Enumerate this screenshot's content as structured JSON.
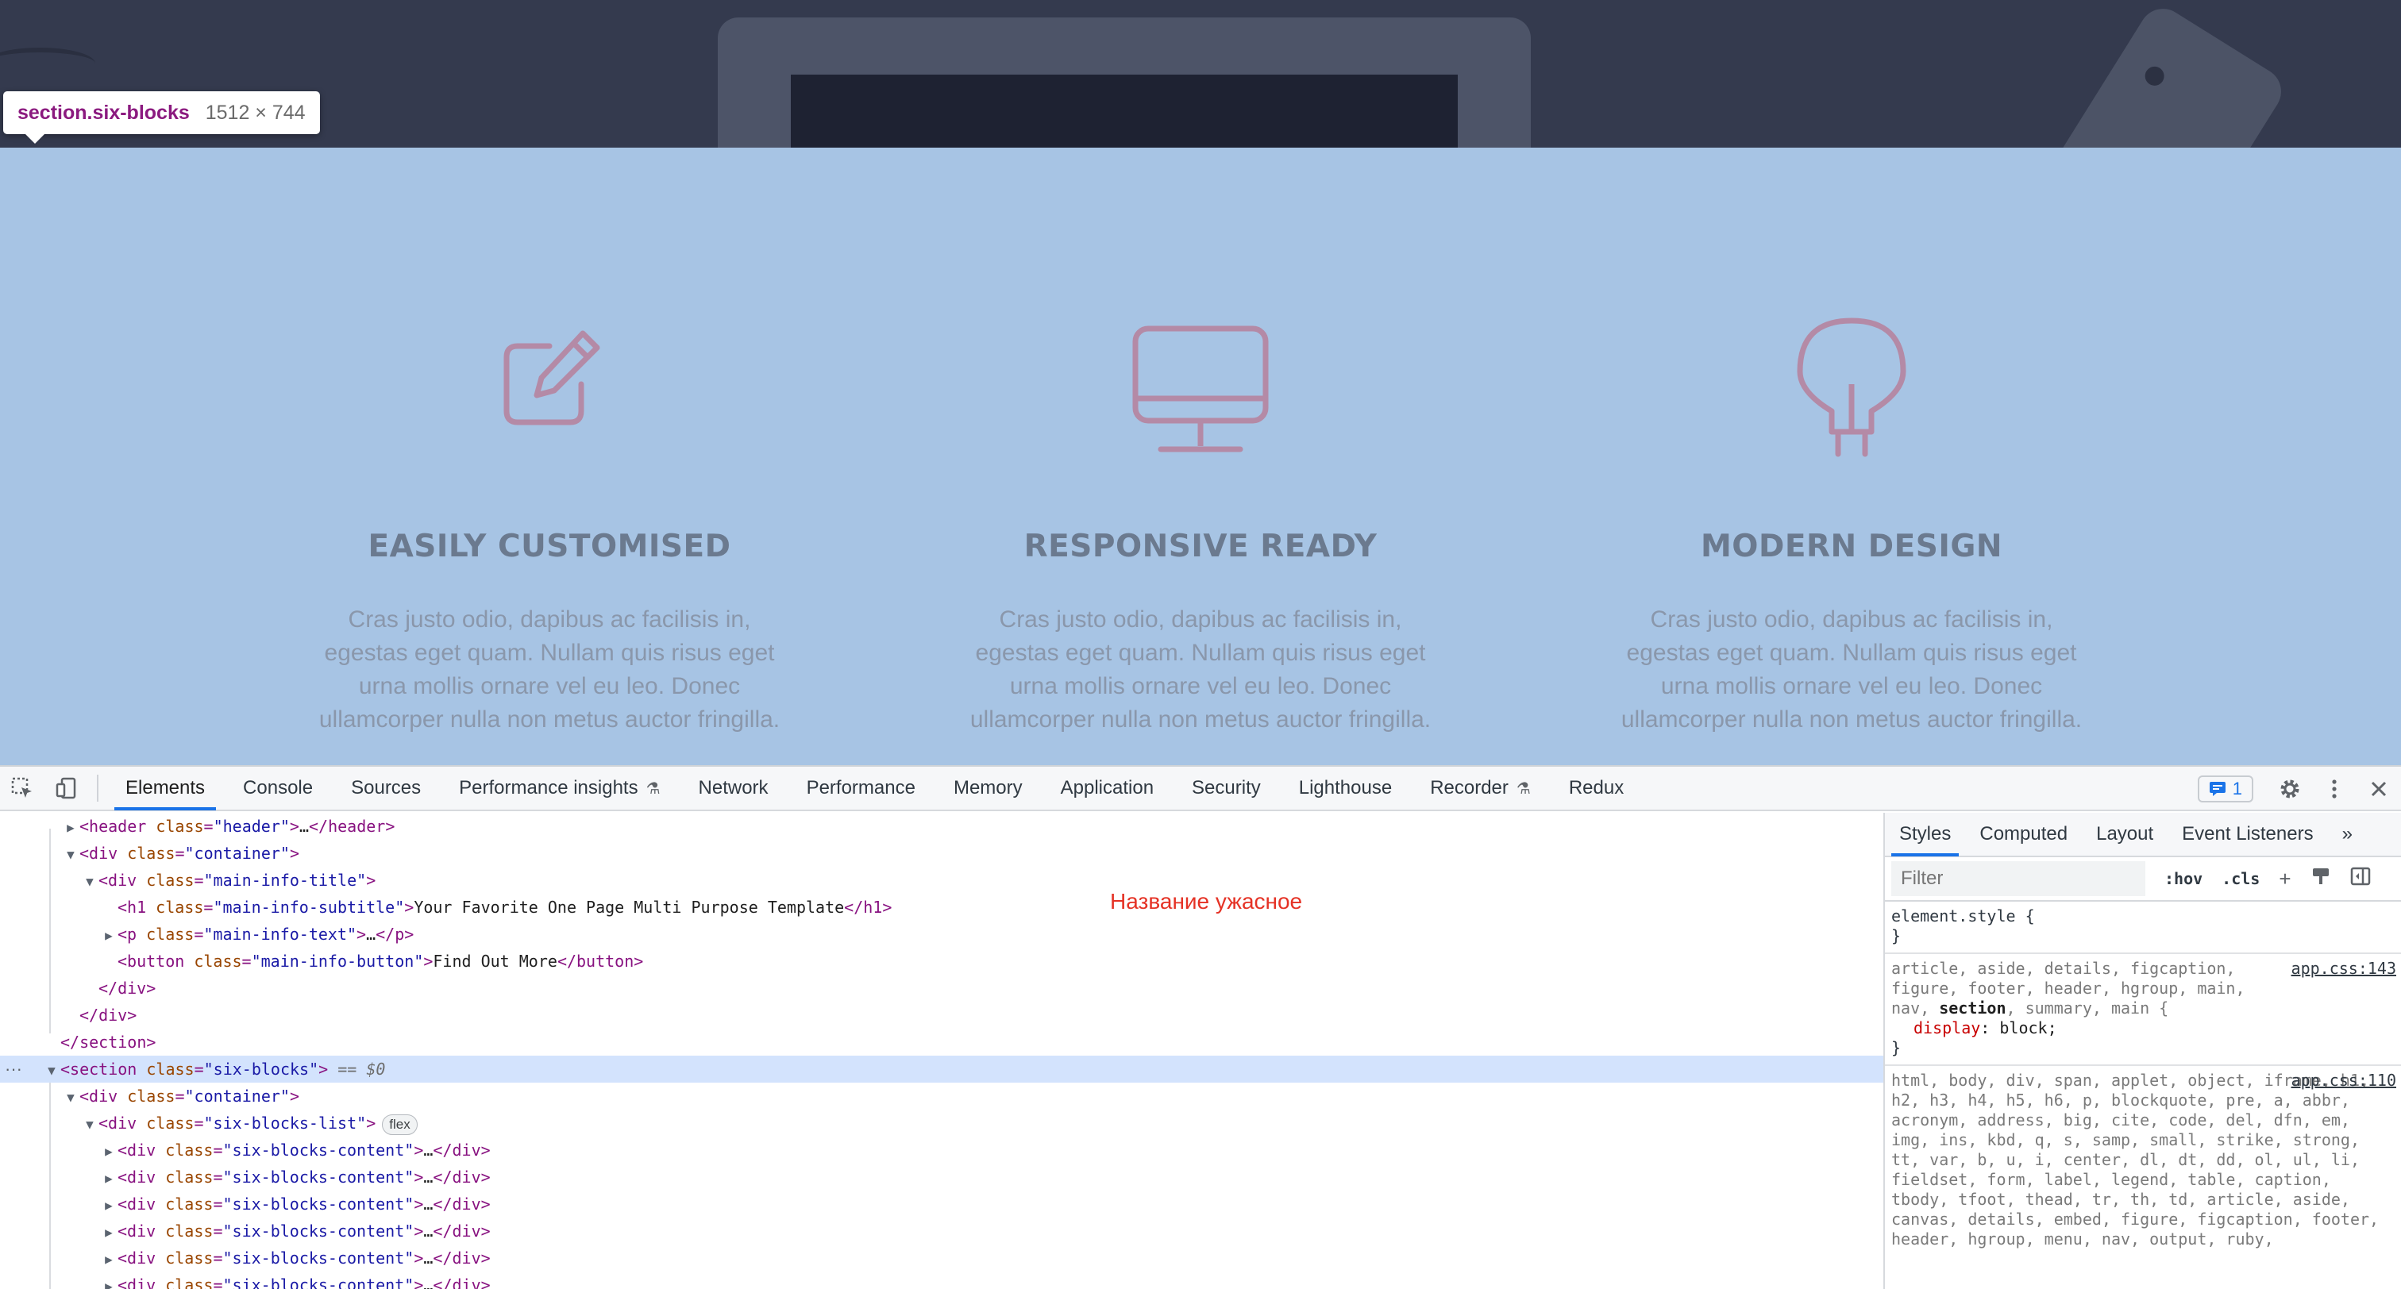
{
  "page": {
    "blocks": [
      {
        "title": "EASILY CUSTOMISED",
        "text": "Cras justo odio, dapibus ac facilisis in, egestas eget quam. Nullam quis risus eget urna mollis ornare vel eu leo. Donec ullamcorper nulla non metus auctor fringilla.",
        "icon": "edit-icon"
      },
      {
        "title": "RESPONSIVE READY",
        "text": "Cras justo odio, dapibus ac facilisis in, egestas eget quam. Nullam quis risus eget urna mollis ornare vel eu leo. Donec ullamcorper nulla non metus auctor fringilla.",
        "icon": "monitor-icon"
      },
      {
        "title": "MODERN DESIGN",
        "text": "Cras justo odio, dapibus ac facilisis in, egestas eget quam. Nullam quis risus eget urna mollis ornare vel eu leo. Donec ullamcorper nulla non metus auctor fringilla.",
        "icon": "lightbulb-icon"
      }
    ],
    "highlight_color": "#a7c4e4",
    "icon_color": "#b48aa6"
  },
  "tooltip": {
    "name": "section.six-blocks",
    "size": "1512 × 744"
  },
  "devtools": {
    "tabs": [
      "Elements",
      "Console",
      "Sources",
      "Performance insights",
      "Network",
      "Performance",
      "Memory",
      "Application",
      "Security",
      "Lighthouse",
      "Recorder",
      "Redux"
    ],
    "active_tab": "Elements",
    "issues_count": "1",
    "elements": {
      "note": "Название ужасное",
      "dollar_ref": "== $0",
      "flex_badge": "flex",
      "lines": {
        "header_open": "<header class=\"header\">…</header>",
        "subtitle_text": "Your Favorite One Page Multi Purpose Template",
        "button_text": "Find Out More",
        "p_text": "…",
        "collapsed": "…"
      }
    },
    "styles": {
      "tabs": [
        "Styles",
        "Computed",
        "Layout",
        "Event Listeners"
      ],
      "more": "»",
      "filter_placeholder": "Filter",
      "hov": ":hov",
      "cls": ".cls",
      "rules": [
        {
          "selector": "element.style {",
          "close": "}"
        },
        {
          "source": "app.css:143",
          "selector_pre": "article, aside, details, figcaption, figure, footer, header, hgroup, main, nav, ",
          "selector_match": "section",
          "selector_post": ", summary, main {",
          "prop": "display",
          "value": "block;",
          "close": "}"
        },
        {
          "source": "app.css:110",
          "selector": "html, body, div, span, applet, object, iframe, h1, h2, h3, h4, h5, h6, p, blockquote, pre, a, abbr, acronym, address, big, cite, code, del, dfn, em, img, ins, kbd, q, s, samp, small, strike, strong, tt, var, b, u, i, center, dl, dt, dd, ol, ul, li, fieldset, form, label, legend, table, caption, tbody, tfoot, thead, tr, th, td, article, aside, canvas, details, embed, figure, figcaption, footer, header, hgroup, menu, nav, output, ruby,"
        }
      ]
    }
  }
}
